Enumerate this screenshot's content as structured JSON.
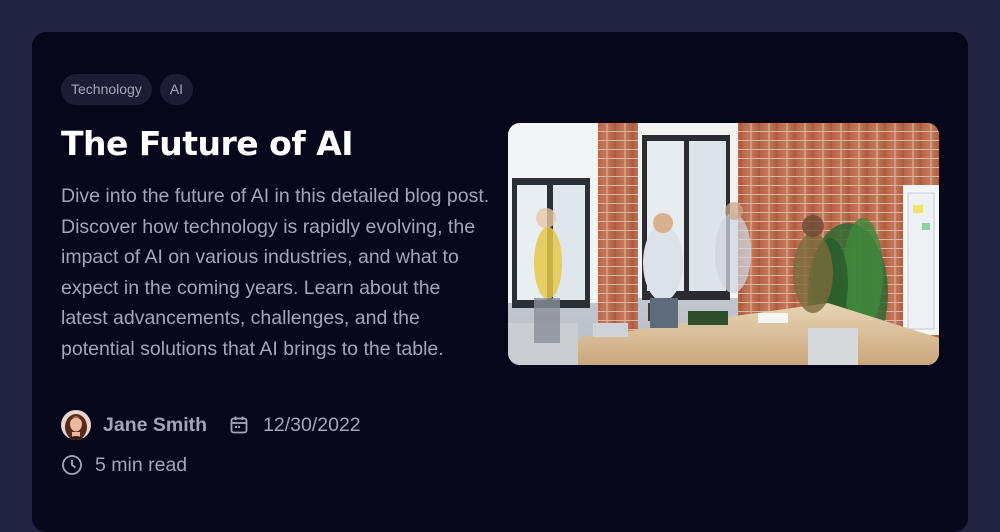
{
  "post": {
    "tags": [
      {
        "label": "Technology"
      },
      {
        "label": "AI"
      }
    ],
    "title": "The Future of AI",
    "description": "Dive into the future of AI in this detailed blog post. Discover how technology is rapidly evolving, the impact of AI on various industries, and what to expect in the coming years. Learn about the latest advancements, challenges, and the potential solutions that AI brings to the table.",
    "author": "Jane Smith",
    "date": "12/30/2022",
    "read_time": "5 min read"
  },
  "icons": {
    "date": "calendar-icon",
    "read_time": "clock-icon"
  },
  "colors": {
    "page_bg": "#222340",
    "card_bg": "#06071b",
    "title": "#ffffff",
    "text": "#a3a5bd",
    "tag_bg": "#1c1d33"
  }
}
